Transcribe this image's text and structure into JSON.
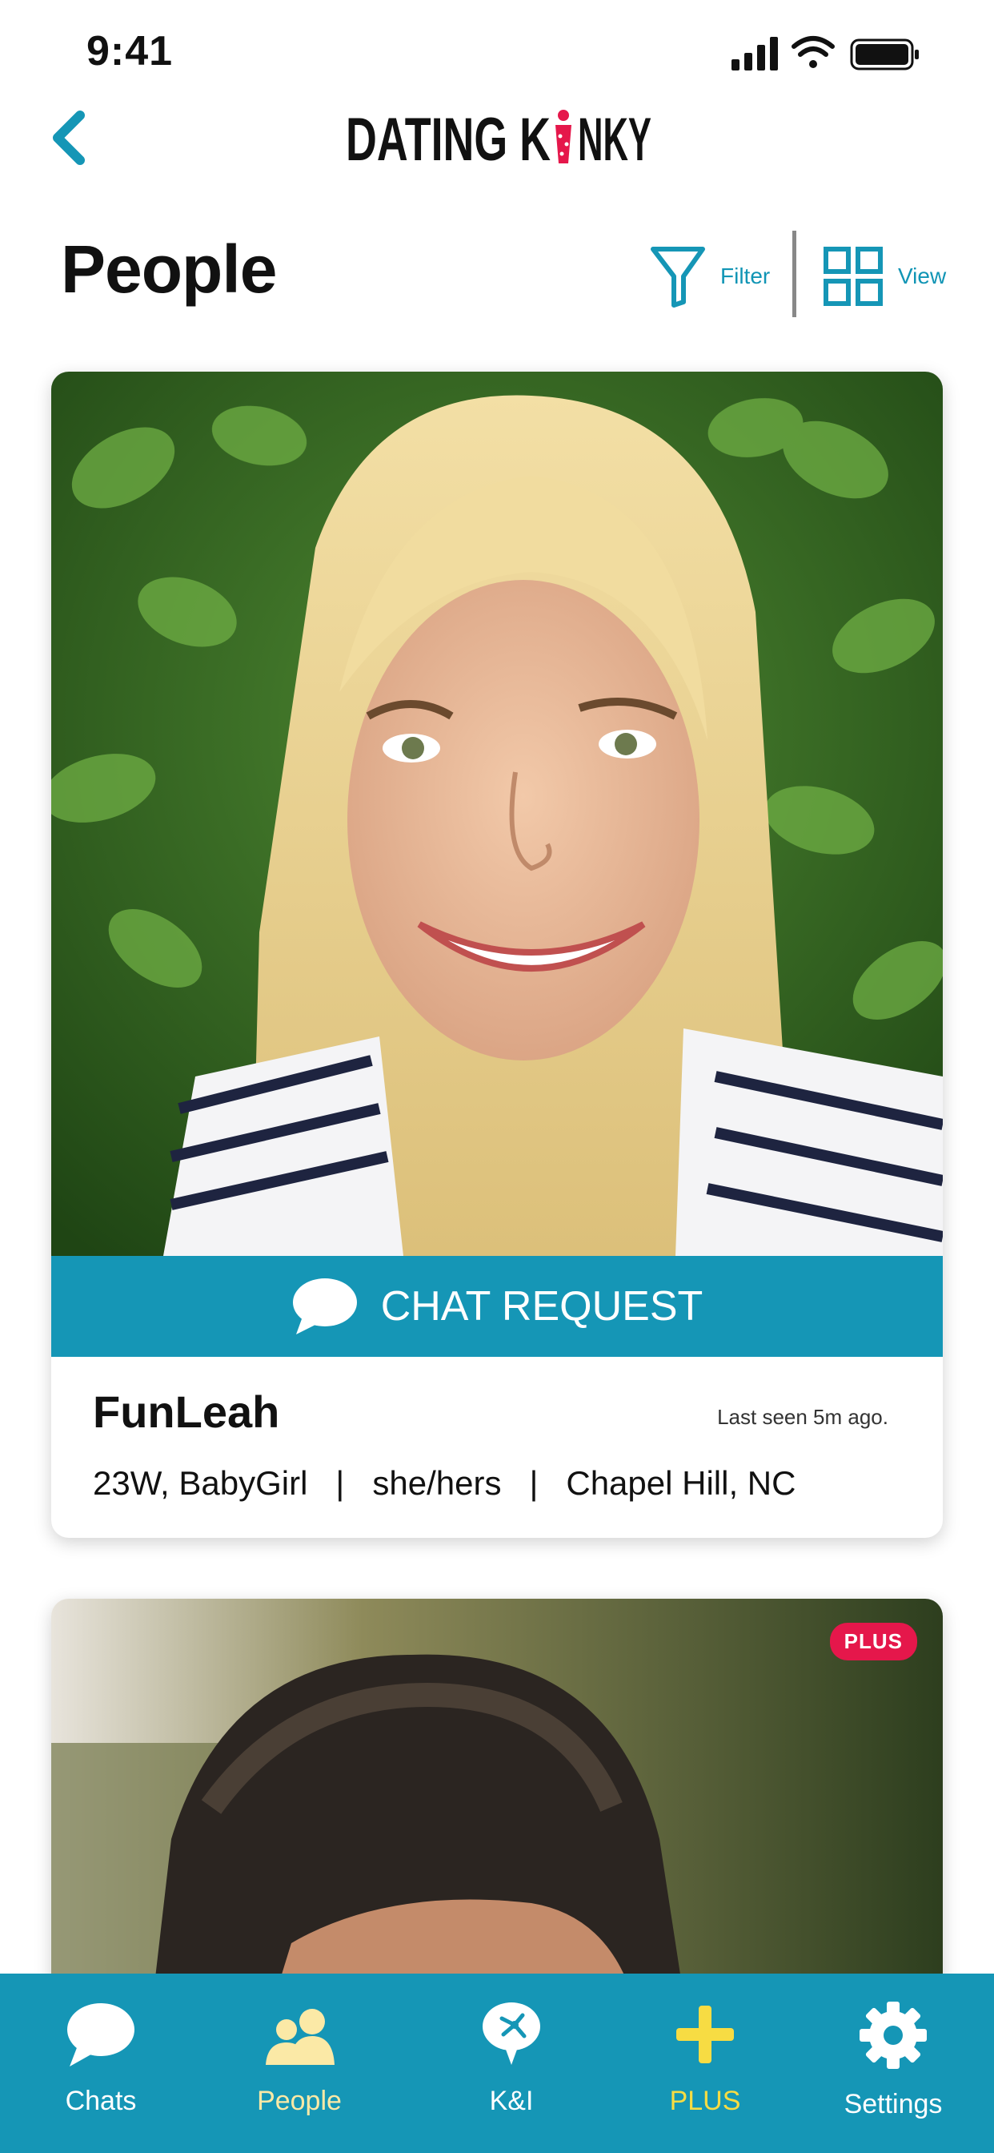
{
  "status_bar": {
    "time": "9:41"
  },
  "header": {
    "logo_text_left": "DATING K",
    "logo_text_right": "NKY"
  },
  "title_row": {
    "title": "People",
    "filter_label": "Filter",
    "view_label": "View"
  },
  "cards": [
    {
      "chat_request_label": "CHAT REQUEST",
      "name": "FunLeah",
      "last_seen": "Last seen 5m ago.",
      "details": "23W, BabyGirl   |   she/hers   |   Chapel Hill, NC"
    },
    {
      "badge": "PLUS"
    }
  ],
  "tab_bar": {
    "tabs": [
      {
        "label": "Chats",
        "icon": "chat-bubble-icon"
      },
      {
        "label": "People",
        "icon": "people-icon"
      },
      {
        "label": "K&I",
        "icon": "kink-interest-icon"
      },
      {
        "label": "PLUS",
        "icon": "plus-icon"
      },
      {
        "label": "Settings",
        "icon": "gear-icon"
      }
    ]
  },
  "colors": {
    "accent": "#1596b6",
    "brand_pink": "#e5174b",
    "plus_yellow": "#f7dc43"
  }
}
